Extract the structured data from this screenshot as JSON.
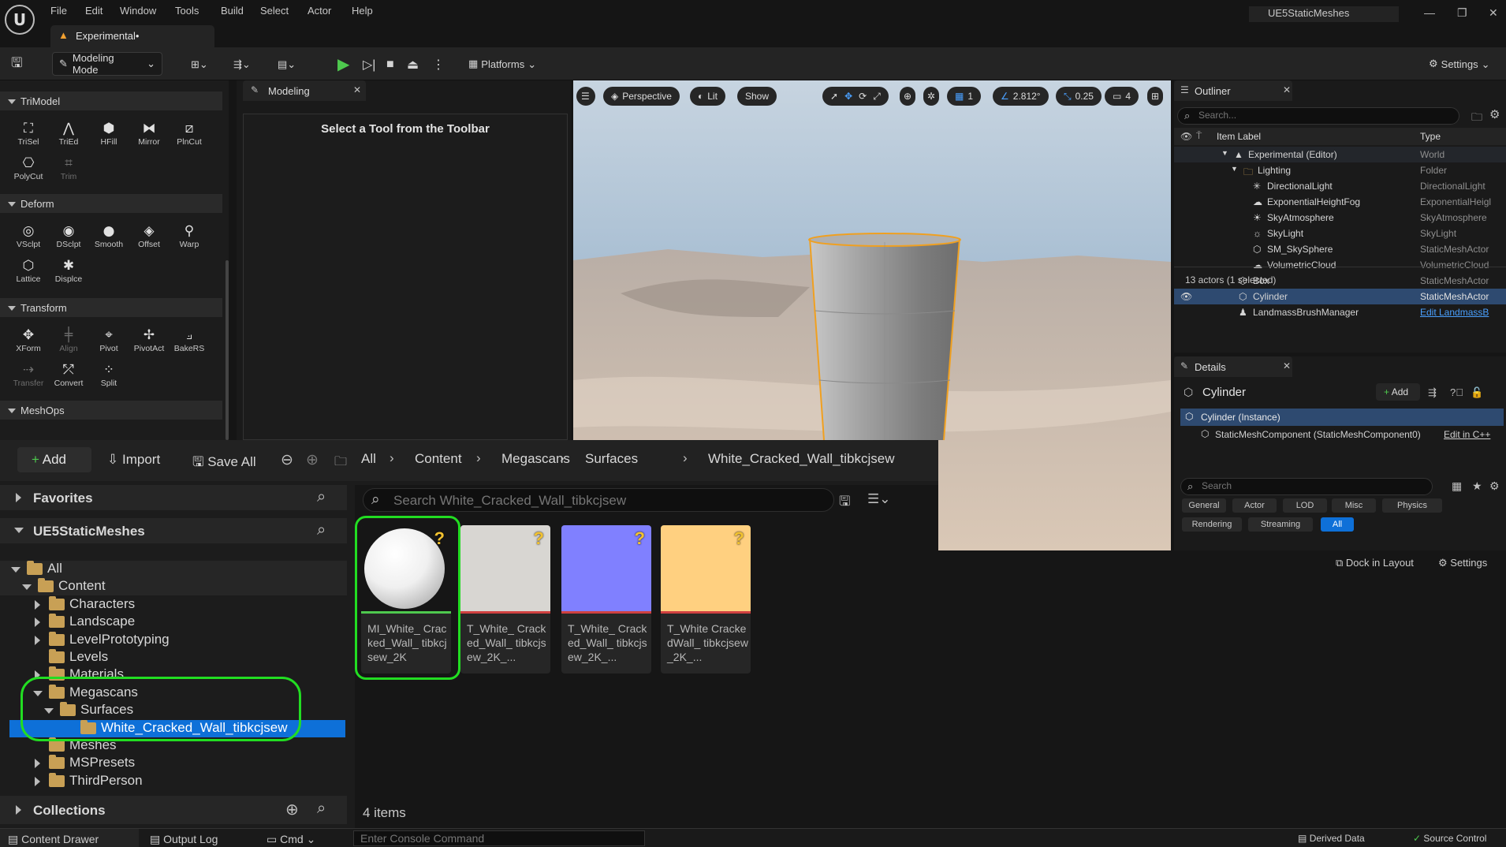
{
  "app": {
    "title": "UE5StaticMeshes",
    "level_tab": "Experimental•"
  },
  "menu": [
    "File",
    "Edit",
    "Window",
    "Tools",
    "Build",
    "Select",
    "Actor",
    "Help"
  ],
  "toolbar": {
    "mode": "Modeling Mode",
    "platforms": "Platforms",
    "settings": "Settings"
  },
  "modeling_panel": {
    "tab": "Modeling",
    "message": "Select a Tool from the Toolbar",
    "categories": [
      {
        "name": "TriModel",
        "tools": [
          "TriSel",
          "TriEd",
          "HFill",
          "Mirror",
          "PlnCut",
          "PolyCut",
          "Trim"
        ]
      },
      {
        "name": "Deform",
        "tools": [
          "VSclpt",
          "DSclpt",
          "Smooth",
          "Offset",
          "Warp",
          "Lattice",
          "Displce"
        ]
      },
      {
        "name": "Transform",
        "tools": [
          "XForm",
          "Align",
          "Pivot",
          "PivotAct",
          "BakeRS",
          "Transfer",
          "Convert",
          "Split"
        ]
      },
      {
        "name": "MeshOps",
        "tools": []
      }
    ]
  },
  "viewport": {
    "perspective": "Perspective",
    "lit": "Lit",
    "show": "Show",
    "grid": "1",
    "angle": "2.812°",
    "scale": "0.25",
    "camera": "4"
  },
  "outliner": {
    "tab": "Outliner",
    "search_placeholder": "Search...",
    "col_label": "Item Label",
    "col_type": "Type",
    "rows": [
      {
        "label": "Experimental (Editor)",
        "type": "World"
      },
      {
        "label": "Lighting",
        "type": "Folder"
      },
      {
        "label": "DirectionalLight",
        "type": "DirectionalLight"
      },
      {
        "label": "ExponentialHeightFog",
        "type": "ExponentialHeigl"
      },
      {
        "label": "SkyAtmosphere",
        "type": "SkyAtmosphere"
      },
      {
        "label": "SkyLight",
        "type": "SkyLight"
      },
      {
        "label": "SM_SkySphere",
        "type": "StaticMeshActor"
      },
      {
        "label": "VolumetricCloud",
        "type": "VolumetricCloud"
      },
      {
        "label": "Box",
        "type": "StaticMeshActor"
      },
      {
        "label": "Cylinder",
        "type": "StaticMeshActor"
      },
      {
        "label": "LandmassBrushManager",
        "type": "Edit LandmassB"
      }
    ],
    "footer": "13 actors (1 selected)"
  },
  "details": {
    "tab": "Details",
    "object": "Cylinder",
    "add": "Add",
    "instance": "Cylinder (Instance)",
    "component": "StaticMeshComponent (StaticMeshComponent0)",
    "edit_cpp": "Edit in C++",
    "search_placeholder": "Search",
    "filters": [
      "General",
      "Actor",
      "LOD",
      "Misc",
      "Physics",
      "Rendering",
      "Streaming",
      "All"
    ],
    "dock": "Dock in Layout",
    "settings": "Settings"
  },
  "content_browser": {
    "add": "Add",
    "import": "Import",
    "save_all": "Save All",
    "breadcrumb": [
      "All",
      "Content",
      "Megascans",
      "Surfaces",
      "White_Cracked_Wall_tibkcjsew"
    ],
    "favorites": "Favorites",
    "project": "UE5StaticMeshes",
    "tree": [
      {
        "label": "All",
        "depth": 0,
        "arrow": "down"
      },
      {
        "label": "Content",
        "depth": 1,
        "arrow": "down"
      },
      {
        "label": "Characters",
        "depth": 2,
        "arrow": "right"
      },
      {
        "label": "Landscape",
        "depth": 2,
        "arrow": "right"
      },
      {
        "label": "LevelPrototyping",
        "depth": 2,
        "arrow": "right"
      },
      {
        "label": "Levels",
        "depth": 2,
        "arrow": "none"
      },
      {
        "label": "Materials",
        "depth": 2,
        "arrow": "right"
      },
      {
        "label": "Megascans",
        "depth": 2,
        "arrow": "down"
      },
      {
        "label": "Surfaces",
        "depth": 3,
        "arrow": "down"
      },
      {
        "label": "White_Cracked_Wall_tibkcjsew",
        "depth": 4,
        "arrow": "none"
      },
      {
        "label": "Meshes",
        "depth": 2,
        "arrow": "none"
      },
      {
        "label": "MSPresets",
        "depth": 2,
        "arrow": "right"
      },
      {
        "label": "ThirdPerson",
        "depth": 2,
        "arrow": "right"
      }
    ],
    "collections": "Collections",
    "search_placeholder": "Search White_Cracked_Wall_tibkcjsew",
    "assets": [
      {
        "name": "MI_White_ Cracked_Wall_ tibkcjsew_2K",
        "thumb": "#ffffff"
      },
      {
        "name": "T_White_ Cracked_Wall_ tibkcjsew_2K_...",
        "thumb": "#d8d6d2"
      },
      {
        "name": "T_White_ Cracked_Wall_ tibkcjsew_2K_...",
        "thumb": "#8080ff"
      },
      {
        "name": "T_White CrackedWall_ tibkcjsew_2K_...",
        "thumb": "#ffd080"
      }
    ],
    "item_count": "4 items"
  },
  "statusbar": {
    "content_drawer": "Content Drawer",
    "output_log": "Output Log",
    "cmd": "Cmd",
    "console_placeholder": "Enter Console Command",
    "derived_data": "Derived Data",
    "source_control": "Source Control"
  },
  "colors": {
    "accent": "#0e70d8",
    "highlight": "#22dd22",
    "folder": "#c8a055"
  }
}
